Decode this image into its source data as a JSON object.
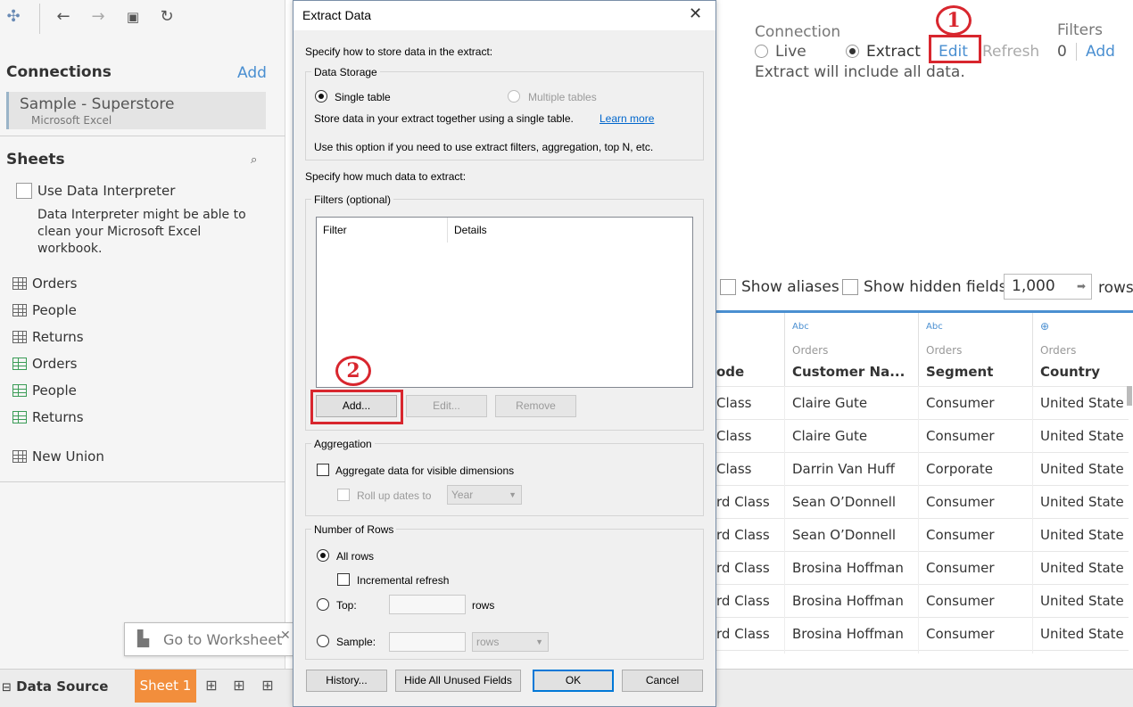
{
  "left": {
    "connections_title": "Connections",
    "add_label": "Add",
    "connection": {
      "name": "Sample - Superstore",
      "type": "Microsoft Excel"
    },
    "sheets_title": "Sheets",
    "interpreter": {
      "label": "Use Data Interpreter",
      "hint_lines": [
        "Data Interpreter might be able to",
        "clean your Microsoft Excel",
        "workbook."
      ]
    },
    "sheets": [
      {
        "label": "Orders",
        "icon": "table-icon"
      },
      {
        "label": "People",
        "icon": "table-icon"
      },
      {
        "label": "Returns",
        "icon": "table-icon"
      },
      {
        "label": "Orders",
        "icon": "named-range-icon"
      },
      {
        "label": "People",
        "icon": "named-range-icon"
      },
      {
        "label": "Returns",
        "icon": "named-range-icon"
      }
    ],
    "new_union": "New Union",
    "tooltip": "Go to Worksheet"
  },
  "tabs": {
    "data_source": "Data Source",
    "sheet": "Sheet 1"
  },
  "connection_panel": {
    "title": "Connection",
    "live": "Live",
    "extract": "Extract",
    "edit": "Edit",
    "refresh": "Refresh",
    "note": "Extract will include all data.",
    "filters_title": "Filters",
    "filters_count": "0",
    "filters_add": "Add"
  },
  "grid_toolbar": {
    "show_aliases": "Show aliases",
    "show_hidden": "Show hidden fields",
    "rows_value": "1,000",
    "rows_label": "rows"
  },
  "grid": {
    "columns": [
      {
        "type": "",
        "source": "",
        "name": "ode"
      },
      {
        "type": "Abc",
        "source": "Orders",
        "name": "Customer Na..."
      },
      {
        "type": "Abc",
        "source": "Orders",
        "name": "Segment"
      },
      {
        "type": "globe",
        "source": "Orders",
        "name": "Country"
      }
    ],
    "rows": [
      [
        "Class",
        "Claire Gute",
        "Consumer",
        "United State"
      ],
      [
        "Class",
        "Claire Gute",
        "Consumer",
        "United State"
      ],
      [
        "Class",
        "Darrin Van Huff",
        "Corporate",
        "United State"
      ],
      [
        "rd Class",
        "Sean O’Donnell",
        "Consumer",
        "United State"
      ],
      [
        "rd Class",
        "Sean O’Donnell",
        "Consumer",
        "United State"
      ],
      [
        "rd Class",
        "Brosina Hoffman",
        "Consumer",
        "United State"
      ],
      [
        "rd Class",
        "Brosina Hoffman",
        "Consumer",
        "United State"
      ],
      [
        "rd Class",
        "Brosina Hoffman",
        "Consumer",
        "United State"
      ]
    ]
  },
  "dialog": {
    "title": "Extract Data",
    "store_prompt": "Specify how to store data in the extract:",
    "storage_group": "Data Storage",
    "single_table": "Single table",
    "multiple_tables": "Multiple tables",
    "single_desc": "Store data in your extract together using a single table.",
    "learn_more": "Learn more",
    "single_use": "Use this option if you need to use extract filters, aggregation, top N, etc.",
    "amount_prompt": "Specify how much data to extract:",
    "filters_group": "Filters (optional)",
    "filter_col": "Filter",
    "details_col": "Details",
    "add_btn": "Add...",
    "edit_btn": "Edit...",
    "remove_btn": "Remove",
    "aggregation_group": "Aggregation",
    "aggregate_label": "Aggregate data for visible dimensions",
    "rollup_label": "Roll up dates to",
    "rollup_value": "Year",
    "rows_group": "Number of Rows",
    "all_rows": "All rows",
    "incremental": "Incremental refresh",
    "top": "Top:",
    "top_unit": "rows",
    "sample": "Sample:",
    "sample_unit": "rows",
    "history_btn": "History...",
    "hide_btn": "Hide All Unused Fields",
    "ok_btn": "OK",
    "cancel_btn": "Cancel"
  },
  "annotations": {
    "step1": "1",
    "step2": "2"
  },
  "colors": {
    "accent": "#4a8fd1",
    "sheet_tab": "#f28e3c",
    "annotation": "#d8262e"
  }
}
